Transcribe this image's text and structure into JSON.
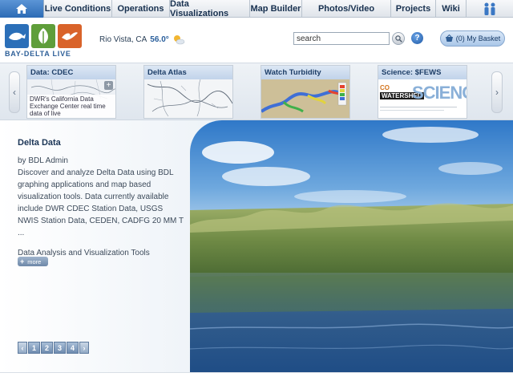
{
  "nav": {
    "home_icon": "home-icon",
    "items": [
      "Live Conditions",
      "Operations",
      "Data Visualizations",
      "Map Builder",
      "Photos/Video",
      "Projects",
      "Wiki"
    ],
    "people_icon": "people-icon"
  },
  "header": {
    "logo_text": "BAY-DELTA LIVE",
    "location": "Rio Vista, CA",
    "temperature": "56.0°",
    "weather_icon": "partly-cloudy-icon",
    "search_value": "search",
    "help_label": "?",
    "basket_label": "(0) My Basket"
  },
  "carousel": {
    "cards": [
      {
        "title": "Data: CDEC",
        "description": "DWR's California Data Exchange Center real time data of live"
      },
      {
        "title": "Delta Atlas"
      },
      {
        "title": "Watch Turbidity"
      },
      {
        "title": "Science: $FEWS",
        "image_text_a": "CO",
        "image_text_b": "WATERSHED",
        "image_text_c": "SCIENCE"
      }
    ],
    "prev": "‹",
    "next": "›",
    "plus": "+"
  },
  "feature": {
    "title": "Delta Data",
    "author": "by BDL Admin",
    "description": "Discover and analyze Delta Data using BDL graphing applications and map based visualization tools. Data currently available include DWR CDEC Station Data, USGS NWIS Station Data, CEDEN, CADFG 20 MM T ...",
    "link": "Data Analysis and Visualization Tools",
    "more": "more",
    "pages": [
      "1",
      "2",
      "3",
      "4"
    ],
    "prev": "‹",
    "next": "›"
  },
  "colors": {
    "brand_blue": "#2d6bb5",
    "nav_text": "#17304f"
  }
}
